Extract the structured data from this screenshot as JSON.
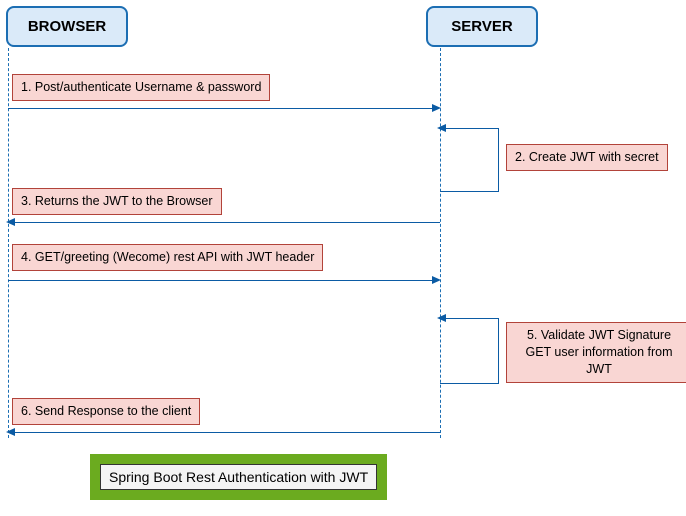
{
  "actors": {
    "browser": "BROWSER",
    "server": "SERVER"
  },
  "steps": {
    "s1": "1. Post/authenticate Username & password",
    "s2": "2. Create JWT with secret",
    "s3": "3. Returns the JWT to the Browser",
    "s4": "4. GET/greeting (Wecome) rest API with JWT header",
    "s5": "5. Validate JWT Signature GET user information from JWT",
    "s6": "6. Send Response to the client"
  },
  "title": "Spring Boot Rest Authentication with JWT"
}
